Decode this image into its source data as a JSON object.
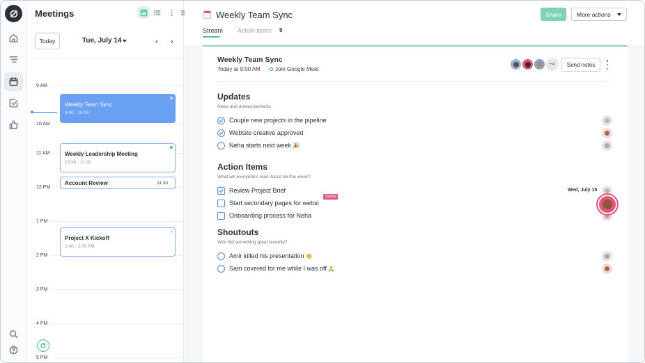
{
  "rail": {
    "items": [
      "home-icon",
      "filters-icon",
      "calendar-icon",
      "tasks-icon",
      "thumbs-up-icon"
    ],
    "bottom": [
      "search-icon",
      "help-icon"
    ]
  },
  "meetings_panel": {
    "title": "Meetings",
    "today_label": "Today",
    "date_label": "Tue, July 14",
    "prev_arrow": "‹",
    "next_arrow": "›",
    "hours": [
      "9 AM",
      "10 AM",
      "11 AM",
      "12 PM",
      "1 PM",
      "2 PM",
      "3 PM",
      "4 PM",
      "5 PM"
    ],
    "events": [
      {
        "title": "Weekly Team Sync",
        "time": "9:00 - 10:00"
      },
      {
        "title": "Weekly Leadership Meeting",
        "time": "10:30 - 11:30"
      },
      {
        "title": "Account Review",
        "time": "11:30"
      },
      {
        "title": "Project X Kickoff",
        "time": "1:00 - 2:00 PM"
      }
    ]
  },
  "header": {
    "title": "Weekly Team Sync",
    "share_label": "Share",
    "more_actions_label": "More actions",
    "tabs": [
      {
        "label": "Stream"
      },
      {
        "label": "Action items",
        "count": "9"
      }
    ]
  },
  "meeting": {
    "title": "Weekly Team Sync",
    "when": "Today at 9:00 AM",
    "join_label": "Join Google Meet",
    "extra_attendees": "+4",
    "send_notes_label": "Send notes"
  },
  "sections": [
    {
      "title": "Updates",
      "subtitle": "News and announcements",
      "items": [
        {
          "text": "Couple new projects in the pipeline",
          "emoji": ""
        },
        {
          "text": "Website creative approved",
          "emoji": ""
        },
        {
          "text": "Neha starts next week",
          "emoji": "🎉"
        }
      ]
    },
    {
      "title": "Action Items",
      "subtitle": "What will everyone's main focus be this week?",
      "items": [
        {
          "text": "Review Project Brief",
          "due": "Wed, July 15"
        },
        {
          "text": "Start secondary pages for websi",
          "tag": "Sasha"
        },
        {
          "text": "Onboarding process for Neha"
        }
      ]
    },
    {
      "title": "Shoutouts",
      "subtitle": "Who did something great recently?",
      "items": [
        {
          "text": "Amir killed his presentation",
          "emoji": "👏"
        },
        {
          "text": "Sam covered for me while I was off",
          "emoji": "🙏"
        }
      ]
    }
  ],
  "colors": {
    "accent_green": "#4cc49a",
    "event_blue": "#6aa0f3",
    "check_blue": "#4d8fe3",
    "tag_pink": "#e8547a"
  }
}
